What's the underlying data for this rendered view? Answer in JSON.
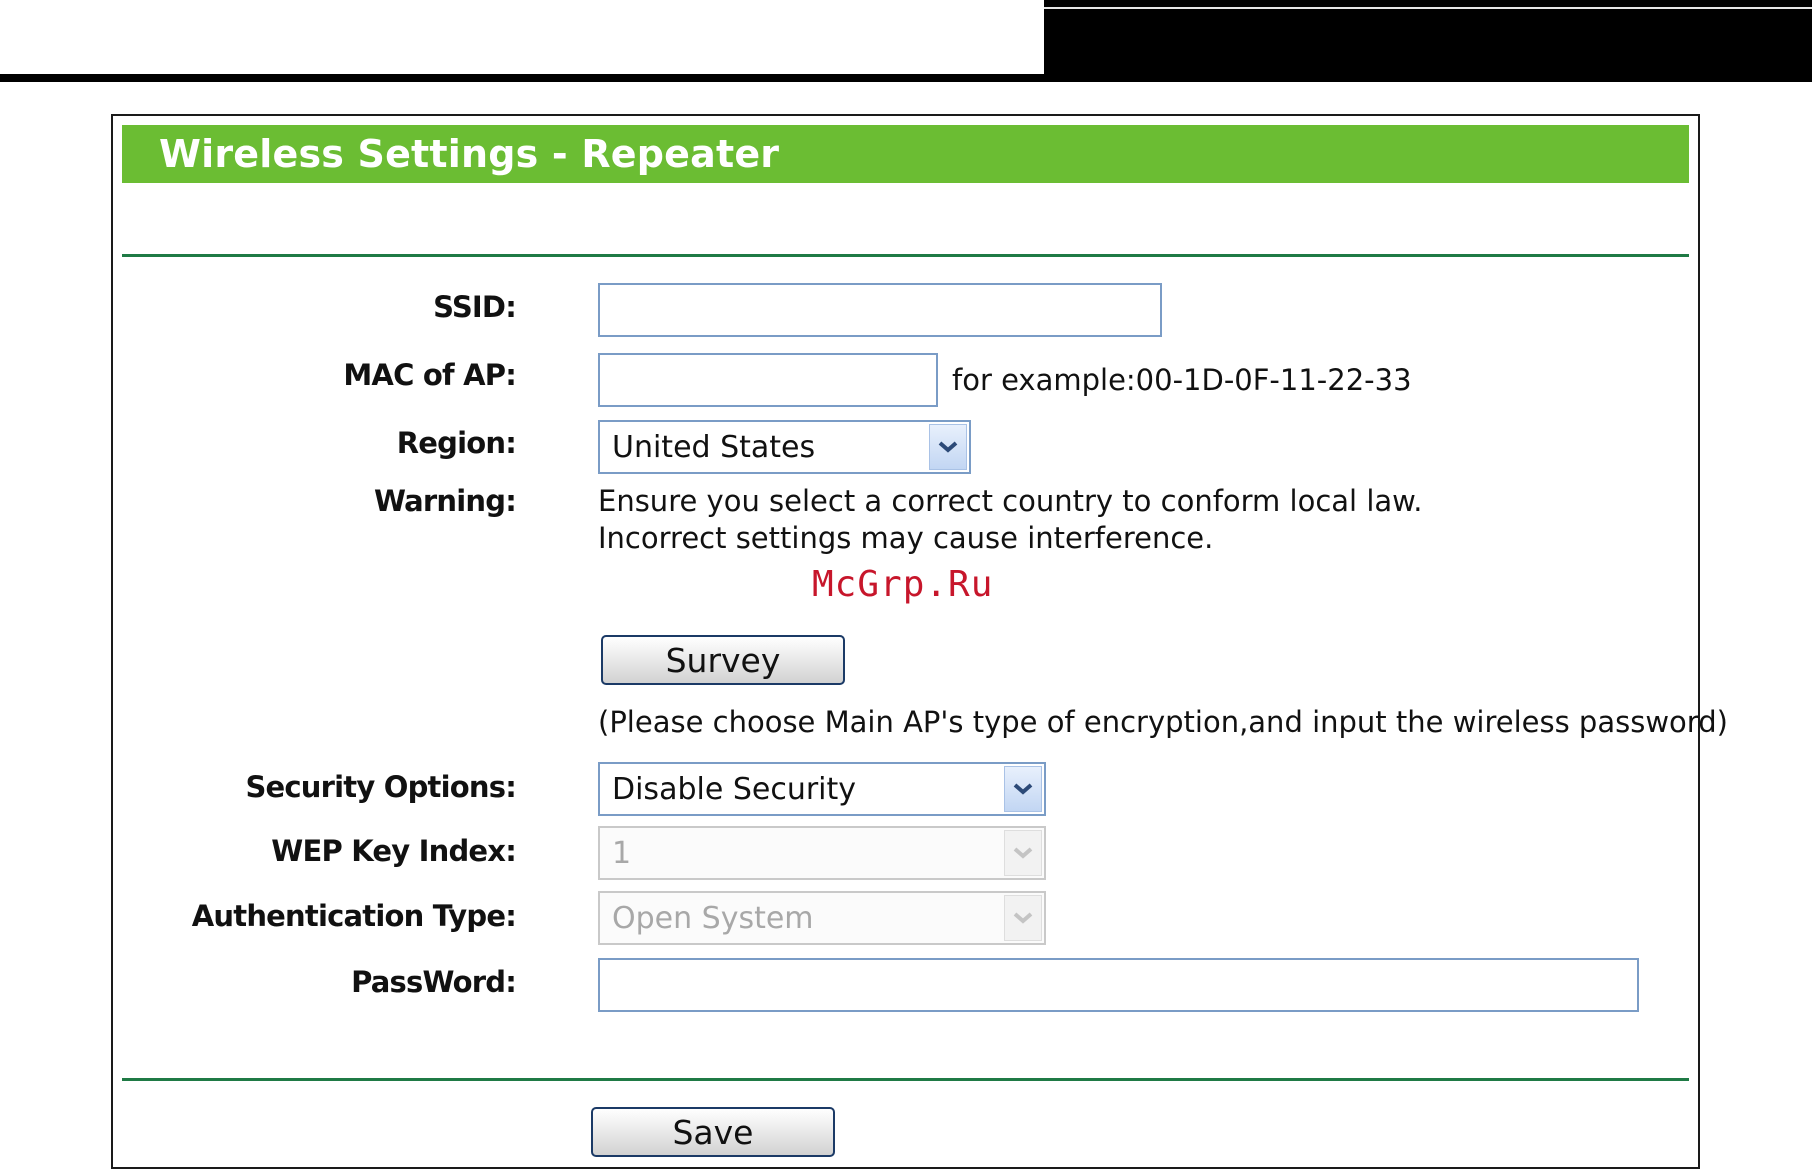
{
  "page": {
    "title": "Wireless Settings - Repeater"
  },
  "form": {
    "ssid": {
      "label": "SSID:",
      "value": ""
    },
    "mac": {
      "label": "MAC of AP:",
      "value": "",
      "hint": "for example:00-1D-0F-11-22-33"
    },
    "region": {
      "label": "Region:",
      "selected": "United States"
    },
    "warning": {
      "label": "Warning:",
      "line1": "Ensure you select a correct country to conform local law.",
      "line2": "Incorrect settings may cause interference."
    },
    "survey_button": "Survey",
    "encryption_note": "(Please choose Main AP's type of encryption,and input the wireless password)",
    "security_options": {
      "label": "Security Options:",
      "selected": "Disable Security"
    },
    "wep_key_index": {
      "label": "WEP Key Index:",
      "selected": "1",
      "disabled": true
    },
    "auth_type": {
      "label": "Authentication Type:",
      "selected": "Open System",
      "disabled": true
    },
    "password": {
      "label": "PassWord:",
      "value": ""
    },
    "save_button": "Save"
  },
  "watermark": "McGrp.Ru",
  "colors": {
    "title_bar": "#6bbd33",
    "rule": "#1f7a45",
    "field_border": "#7a9cc6",
    "watermark": "#c7162b"
  },
  "icons": {
    "dropdown": "chevron-down-icon"
  }
}
